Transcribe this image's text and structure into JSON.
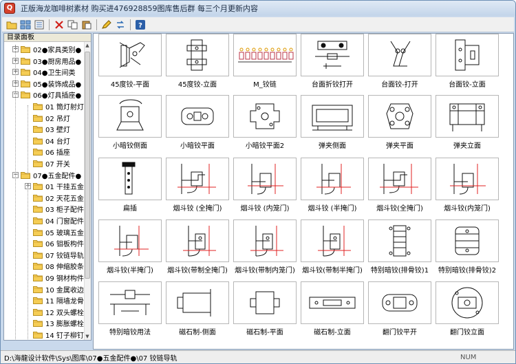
{
  "window": {
    "title": "正版海龙咖啡树素材 购买进476928859图库售后群 每三个月更新内容",
    "app_icon": "Q"
  },
  "toolbar": {
    "icons": [
      "open-folder-icon",
      "thumbnails-view-icon",
      "list-view-icon",
      "delete-icon",
      "copy-icon",
      "paste-icon",
      "edit-icon",
      "refresh-icon",
      "help-icon"
    ]
  },
  "sidebar": {
    "title": "目录面板",
    "items": [
      {
        "label": "02●家具类别●",
        "level": 1,
        "expander": "+"
      },
      {
        "label": "03●厨房用品●",
        "level": 1,
        "expander": "+"
      },
      {
        "label": "04●卫生间类",
        "level": 1,
        "expander": "+"
      },
      {
        "label": "05●装饰成品●",
        "level": 1,
        "expander": "+"
      },
      {
        "label": "06●灯具插座●",
        "level": 1,
        "expander": "−"
      },
      {
        "label": "01 筒灯射灯",
        "level": 2,
        "expander": ""
      },
      {
        "label": "02 吊灯",
        "level": 2,
        "expander": ""
      },
      {
        "label": "03 壁灯",
        "level": 2,
        "expander": ""
      },
      {
        "label": "04 台灯",
        "level": 2,
        "expander": ""
      },
      {
        "label": "06 插座",
        "level": 2,
        "expander": ""
      },
      {
        "label": "07 开关",
        "level": 2,
        "expander": ""
      },
      {
        "label": "07●五金配件●",
        "level": 1,
        "expander": "−"
      },
      {
        "label": "01 干挂五金",
        "level": 2,
        "expander": "+"
      },
      {
        "label": "02 天花五金",
        "level": 2,
        "expander": ""
      },
      {
        "label": "03 柜子配件",
        "level": 2,
        "expander": ""
      },
      {
        "label": "04 门窗配件",
        "level": 2,
        "expander": ""
      },
      {
        "label": "05 玻璃五金",
        "level": 2,
        "expander": ""
      },
      {
        "label": "06 钼板构件",
        "level": 2,
        "expander": ""
      },
      {
        "label": "07 铰链导轨",
        "level": 2,
        "expander": ""
      },
      {
        "label": "08 伸缩胶条",
        "level": 2,
        "expander": ""
      },
      {
        "label": "09 钢材构件",
        "level": 2,
        "expander": ""
      },
      {
        "label": "10 金属收边",
        "level": 2,
        "expander": ""
      },
      {
        "label": "11 隔墙龙骨",
        "level": 2,
        "expander": ""
      },
      {
        "label": "12 双头螺栓",
        "level": 2,
        "expander": ""
      },
      {
        "label": "13 膨胀螺栓",
        "level": 2,
        "expander": ""
      },
      {
        "label": "14 钉子柳钉",
        "level": 2,
        "expander": ""
      }
    ]
  },
  "grid": {
    "tiles": [
      {
        "label": "45度铰-平面",
        "icon": "hinge-45-plan-icon"
      },
      {
        "label": "45度铰-立面",
        "icon": "hinge-45-elevation-icon"
      },
      {
        "label": "M_铰链",
        "icon": "hinge-set-icon"
      },
      {
        "label": "台面折铰打开",
        "icon": "table-fold-hinge-open-icon"
      },
      {
        "label": "台面铰-打开",
        "icon": "table-hinge-open-icon"
      },
      {
        "label": "台面铰-立面",
        "icon": "table-hinge-elevation-icon"
      },
      {
        "label": "小暗铰侧面",
        "icon": "concealed-hinge-side-icon"
      },
      {
        "label": "小暗铰平面",
        "icon": "concealed-hinge-plan-icon"
      },
      {
        "label": "小暗铰平面2",
        "icon": "concealed-hinge-plan2-icon"
      },
      {
        "label": "弹夹侧面",
        "icon": "spring-clip-side-icon"
      },
      {
        "label": "弹夹平面",
        "icon": "spring-clip-plan-icon"
      },
      {
        "label": "弹夹立面",
        "icon": "spring-clip-elevation-icon"
      },
      {
        "label": "扁插",
        "icon": "flat-pin-icon"
      },
      {
        "label": "烟斗铰 (全掩门)",
        "icon": "pipe-hinge-full-icon"
      },
      {
        "label": "烟斗铰 (内笼门)",
        "icon": "pipe-hinge-inset-icon"
      },
      {
        "label": "烟斗铰 (半掩门)",
        "icon": "pipe-hinge-half-icon"
      },
      {
        "label": "烟斗铰(全掩门)",
        "icon": "pipe-hinge-full-2-icon"
      },
      {
        "label": "烟斗铰(内笼门)",
        "icon": "pipe-hinge-inset-2-icon"
      },
      {
        "label": "烟斗铰(半掩门)",
        "icon": "pipe-hinge-half-2-icon"
      },
      {
        "label": "烟斗铰(带制全掩门)",
        "icon": "pipe-hinge-damped-full-icon"
      },
      {
        "label": "烟斗铰(带制内笼门)",
        "icon": "pipe-hinge-damped-inset-icon"
      },
      {
        "label": "烟斗铰(带制半掩门)",
        "icon": "pipe-hinge-damped-half-icon"
      },
      {
        "label": "特别暗铰(排骨铰)1",
        "icon": "rib-hinge-1-icon"
      },
      {
        "label": "特别暗铰(排骨铰)2",
        "icon": "rib-hinge-2-icon"
      },
      {
        "label": "特别暗铰用法",
        "icon": "hinge-usage-icon"
      },
      {
        "label": "磁石制-侧面",
        "icon": "magnet-catch-side-icon"
      },
      {
        "label": "磁石制-平面",
        "icon": "magnet-catch-plan-icon"
      },
      {
        "label": "磁石制-立面",
        "icon": "magnet-catch-elevation-icon"
      },
      {
        "label": "翻门铰平开",
        "icon": "flap-hinge-open-icon"
      },
      {
        "label": "翻门铰立面",
        "icon": "flap-hinge-elevation-icon"
      }
    ]
  },
  "statusbar": {
    "path": "D:\\海龍设计软件\\Sys\\图库\\07●五金配件●\\07 铰链导轨",
    "num": "NUM"
  }
}
